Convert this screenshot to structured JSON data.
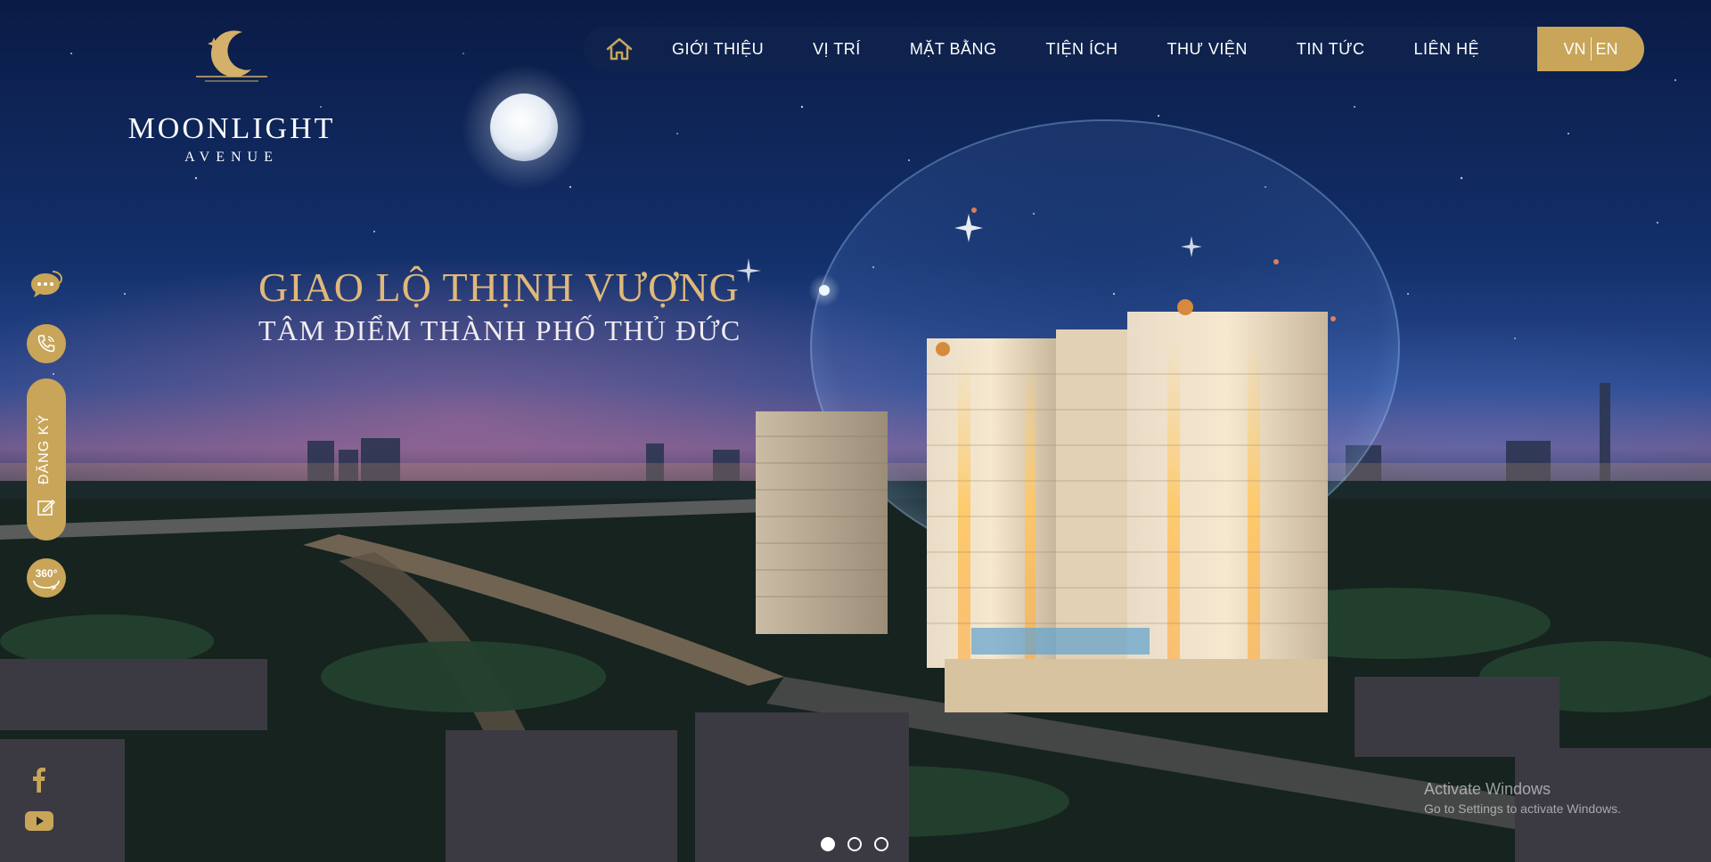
{
  "brand": {
    "name": "MOONLIGHT",
    "subname": "AVENUE"
  },
  "nav": {
    "home_icon": "home-icon",
    "items": [
      {
        "label": "GIỚI THIỆU"
      },
      {
        "label": "VỊ TRÍ"
      },
      {
        "label": "MẶT BẰNG"
      },
      {
        "label": "TIỆN ÍCH"
      },
      {
        "label": "THƯ VIỆN"
      },
      {
        "label": "TIN TỨC"
      },
      {
        "label": "LIÊN HỆ"
      }
    ],
    "lang": {
      "vn": "VN",
      "en": "EN"
    }
  },
  "hero": {
    "headline": "GIAO LỘ THỊNH VƯỢNG",
    "subheadline": "TÂM ĐIỂM THÀNH PHỐ THỦ ĐỨC",
    "slides_total": 3,
    "slide_active": 1
  },
  "side_tools": {
    "chat_icon": "chat-icon",
    "phone_icon": "phone-icon",
    "register_label": "ĐĂNG KÝ",
    "register_icon": "edit-icon",
    "tour_label": "360°",
    "facebook_icon": "facebook-icon",
    "youtube_icon": "youtube-icon"
  },
  "watermark": {
    "line1": "Activate Windows",
    "line2": "Go to Settings to activate Windows."
  },
  "colors": {
    "gold": "#c8a559",
    "headline_gold": "#e0b97a",
    "nav_bg": "#10244e"
  }
}
